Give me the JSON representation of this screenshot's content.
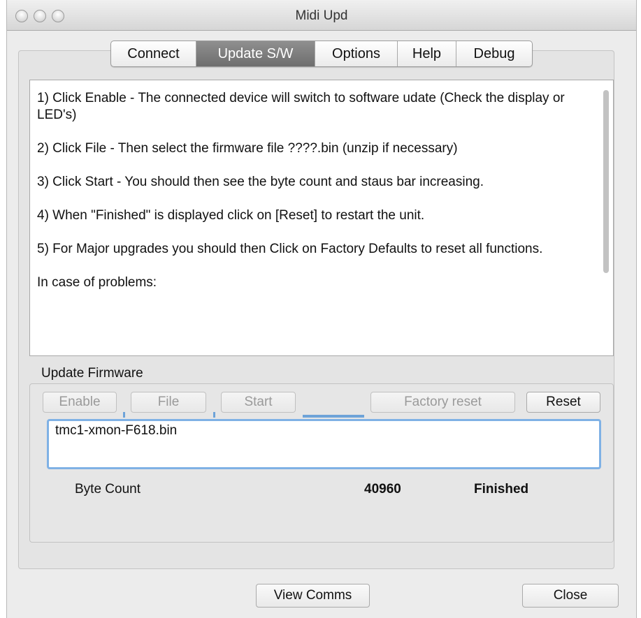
{
  "window": {
    "title": "Midi  Upd"
  },
  "tabs": [
    {
      "label": "Connect",
      "active": false
    },
    {
      "label": "Update S/W",
      "active": true
    },
    {
      "label": "Options",
      "active": false
    },
    {
      "label": "Help",
      "active": false
    },
    {
      "label": "Debug",
      "active": false
    }
  ],
  "instructions": {
    "paragraphs": [
      "1) Click Enable - The connected device will switch to software udate (Check the display or LED's)",
      "2) Click File - Then select the firmware file ????.bin (unzip if necessary)",
      "3) Click Start - You should then see the byte count and staus bar increasing.",
      "4) When \"Finished\" is displayed click on [Reset] to restart the unit.",
      "5) For Major upgrades you should then Click on Factory Defaults to reset all functions.",
      "In case of problems:"
    ]
  },
  "update_firmware": {
    "label": "Update Firmware",
    "buttons": {
      "enable": "Enable",
      "file": "File",
      "start": "Start",
      "factory_reset": "Factory reset",
      "reset": "Reset"
    },
    "filename": "tmc1-xmon-F618.bin",
    "byte_count_label": "Byte Count",
    "byte_count_value": "40960",
    "status": "Finished"
  },
  "footer": {
    "view_comms": "View Comms",
    "close": "Close"
  }
}
